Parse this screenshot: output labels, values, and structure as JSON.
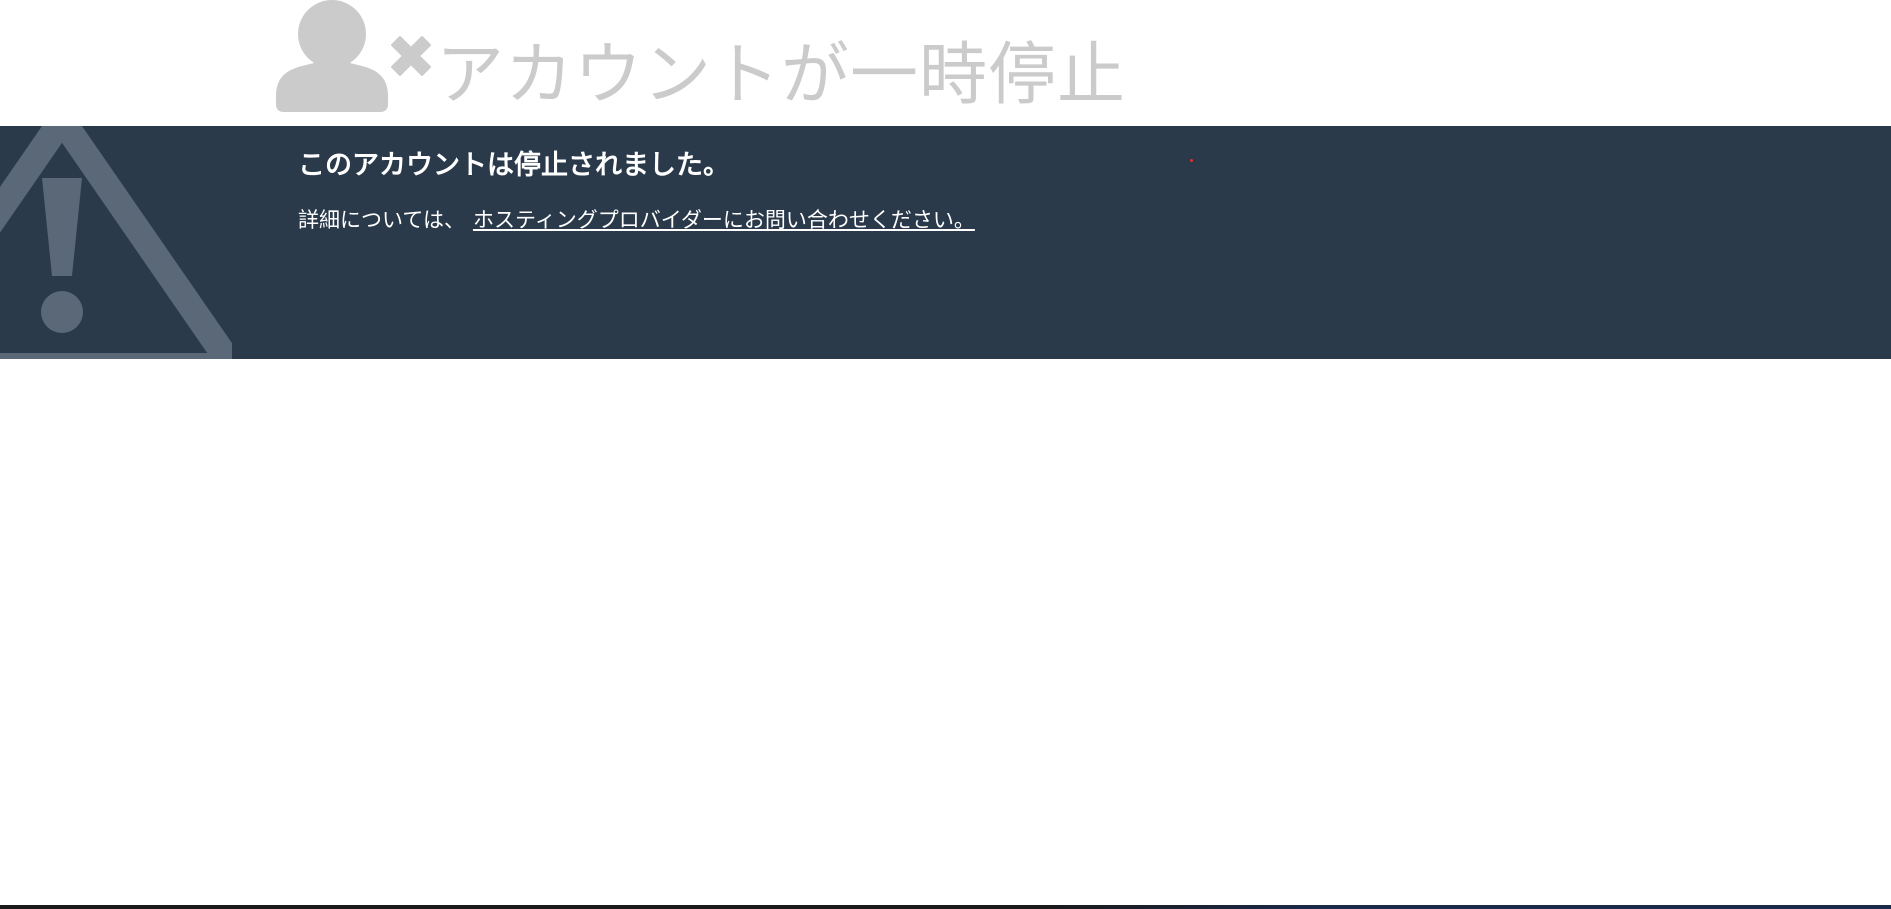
{
  "header": {
    "title": "アカウントが一時停止",
    "user_icon": "user-icon",
    "x_icon": "close-x-icon"
  },
  "banner": {
    "icon": "warning-triangle-icon",
    "heading": "このアカウントは停止されました。",
    "body_prefix": "詳細については、",
    "link_text": "ホスティングプロバイダーにお問い合わせください。"
  },
  "colors": {
    "banner_bg": "#2a3a4b",
    "header_text": "#cbcbcb",
    "icon_gray": "#cbcbcb",
    "warning_icon": "#5a6877"
  }
}
